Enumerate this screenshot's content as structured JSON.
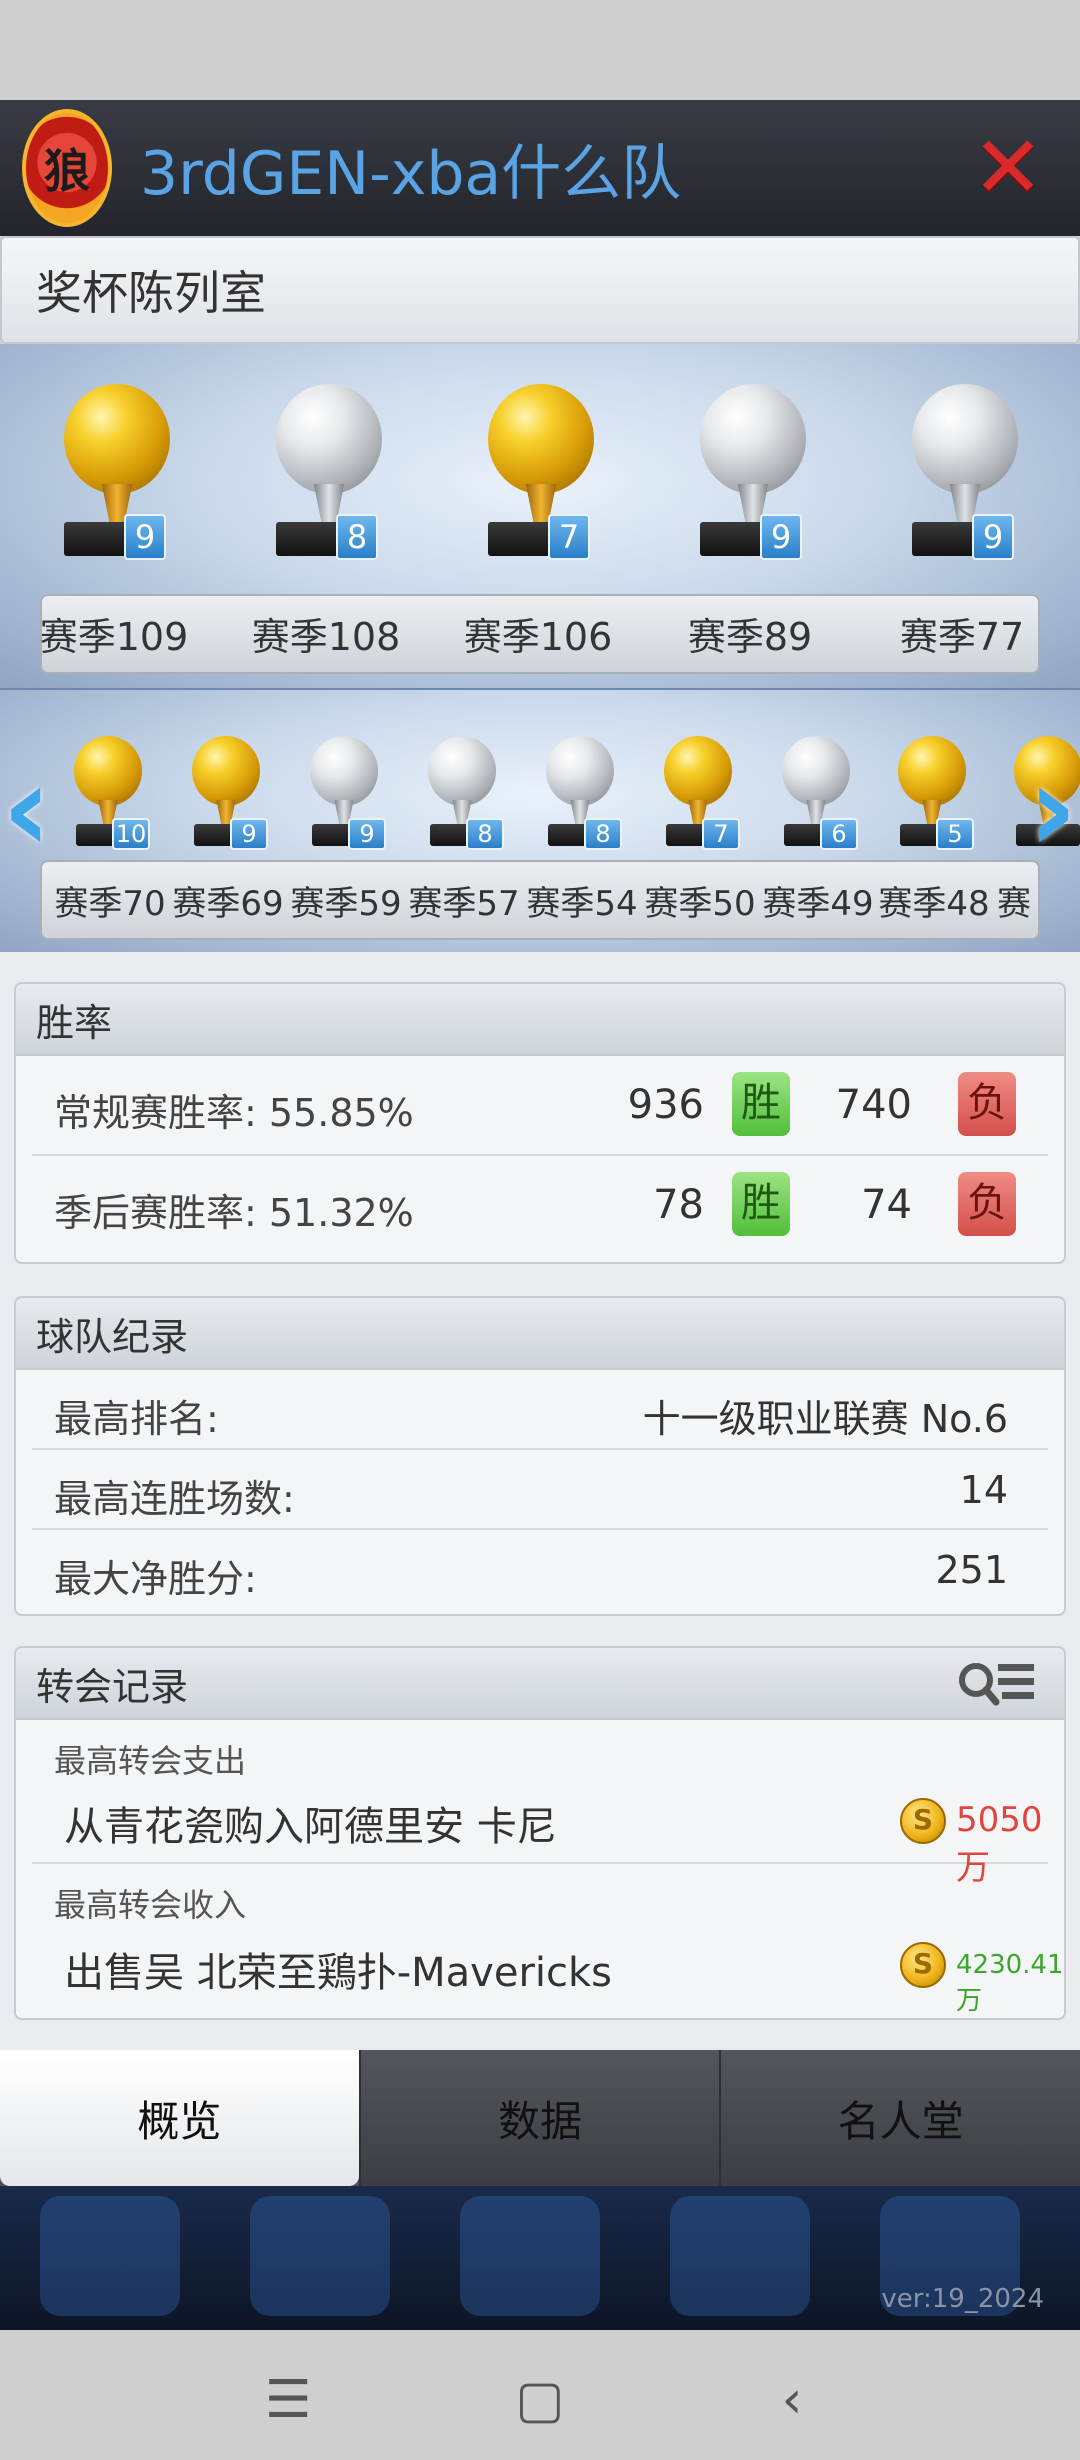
{
  "header": {
    "title": "3rdGEN-xba什么队"
  },
  "trophy_room": {
    "title": "奖杯陈列室",
    "row1": [
      {
        "label": "赛季109",
        "count": "9",
        "type": "gold"
      },
      {
        "label": "赛季108",
        "count": "8",
        "type": "silver"
      },
      {
        "label": "赛季106",
        "count": "7",
        "type": "gold"
      },
      {
        "label": "赛季89",
        "count": "9",
        "type": "silver"
      },
      {
        "label": "赛季77",
        "count": "9",
        "type": "silver"
      }
    ],
    "row2": [
      {
        "label": "赛季70",
        "count": "10",
        "type": "gold"
      },
      {
        "label": "赛季69",
        "count": "9",
        "type": "gold"
      },
      {
        "label": "赛季59",
        "count": "9",
        "type": "silver"
      },
      {
        "label": "赛季57",
        "count": "8",
        "type": "silver"
      },
      {
        "label": "赛季54",
        "count": "8",
        "type": "silver"
      },
      {
        "label": "赛季50",
        "count": "7",
        "type": "gold"
      },
      {
        "label": "赛季49",
        "count": "6",
        "type": "silver"
      },
      {
        "label": "赛季48",
        "count": "5",
        "type": "gold"
      },
      {
        "label": "赛",
        "count": "",
        "type": "gold"
      }
    ]
  },
  "win_rate": {
    "title": "胜率",
    "regular": {
      "label": "常规赛胜率: 55.85%",
      "wins": "936",
      "win_badge": "胜",
      "losses": "740",
      "loss_badge": "负"
    },
    "playoff": {
      "label": "季后赛胜率: 51.32%",
      "wins": "78",
      "win_badge": "胜",
      "losses": "74",
      "loss_badge": "负"
    }
  },
  "team_record": {
    "title": "球队纪录",
    "rows": [
      {
        "label": "最高排名:",
        "value": "十一级职业联赛 No.6"
      },
      {
        "label": "最高连胜场数:",
        "value": "14"
      },
      {
        "label": "最大净胜分:",
        "value": "251"
      }
    ]
  },
  "transfer": {
    "title": "转会记录",
    "expense": {
      "title": "最高转会支出",
      "desc": "从青花瓷购入阿德里安 卡尼",
      "amount": "5050万",
      "amount_color": "#e0443c"
    },
    "income": {
      "title": "最高转会收入",
      "desc": "出售吴 北荣至鶏扑-Mavericks",
      "amount": "4230.41万",
      "amount_color": "#3aa62a"
    }
  },
  "tabs": [
    {
      "label": "概览",
      "active": true
    },
    {
      "label": "数据",
      "active": false
    },
    {
      "label": "名人堂",
      "active": false
    }
  ],
  "footer": {
    "version": "ver:19_2024"
  },
  "icons": {
    "close": "close-icon",
    "list": "search-list-icon",
    "coin": "coin-icon",
    "nav_left": "chevron-left-icon",
    "nav_right": "chevron-right-icon"
  }
}
